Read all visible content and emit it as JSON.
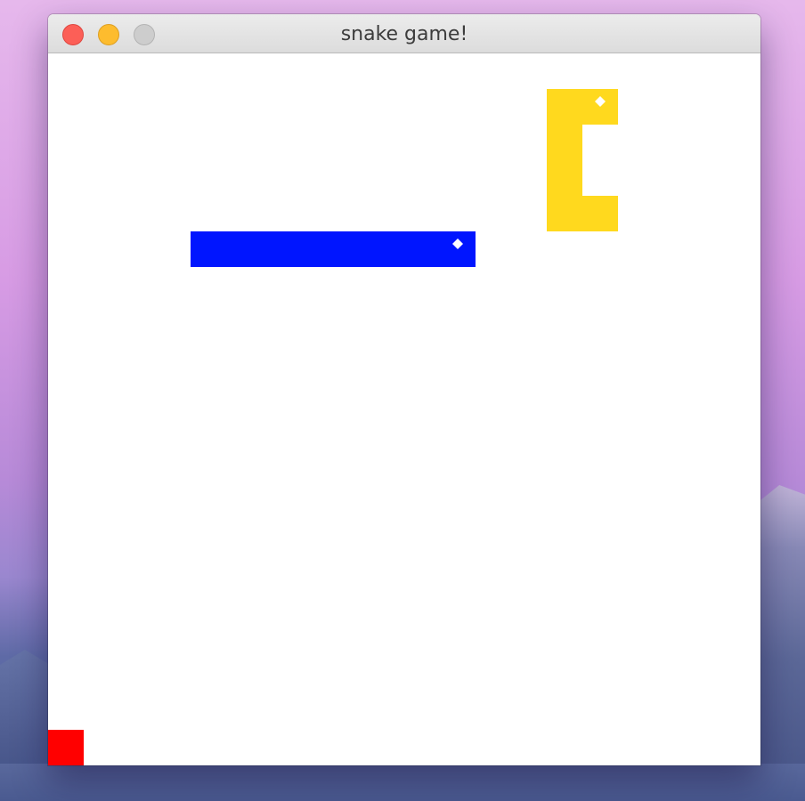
{
  "window": {
    "title": "snake game!"
  },
  "colors": {
    "background": "#ffffff",
    "food": "#ff0000",
    "snake_blue": "#0015ff",
    "snake_yellow": "#ffd91e",
    "eye": "#ffffff"
  },
  "game": {
    "grid_cells": 20,
    "food": {
      "col": 0,
      "row": 19,
      "color": "#ff0000"
    },
    "snakes": [
      {
        "color": "#0015ff",
        "head": {
          "col": 11,
          "row": 5
        },
        "cells": [
          [
            4,
            5
          ],
          [
            5,
            5
          ],
          [
            6,
            5
          ],
          [
            7,
            5
          ],
          [
            8,
            5
          ],
          [
            9,
            5
          ],
          [
            10,
            5
          ],
          [
            11,
            5
          ]
        ]
      },
      {
        "color": "#ffd91e",
        "head": {
          "col": 15,
          "row": 1
        },
        "cells": [
          [
            15,
            1
          ],
          [
            14,
            1
          ],
          [
            14,
            2
          ],
          [
            14,
            3
          ],
          [
            14,
            4
          ],
          [
            15,
            4
          ]
        ]
      }
    ]
  }
}
